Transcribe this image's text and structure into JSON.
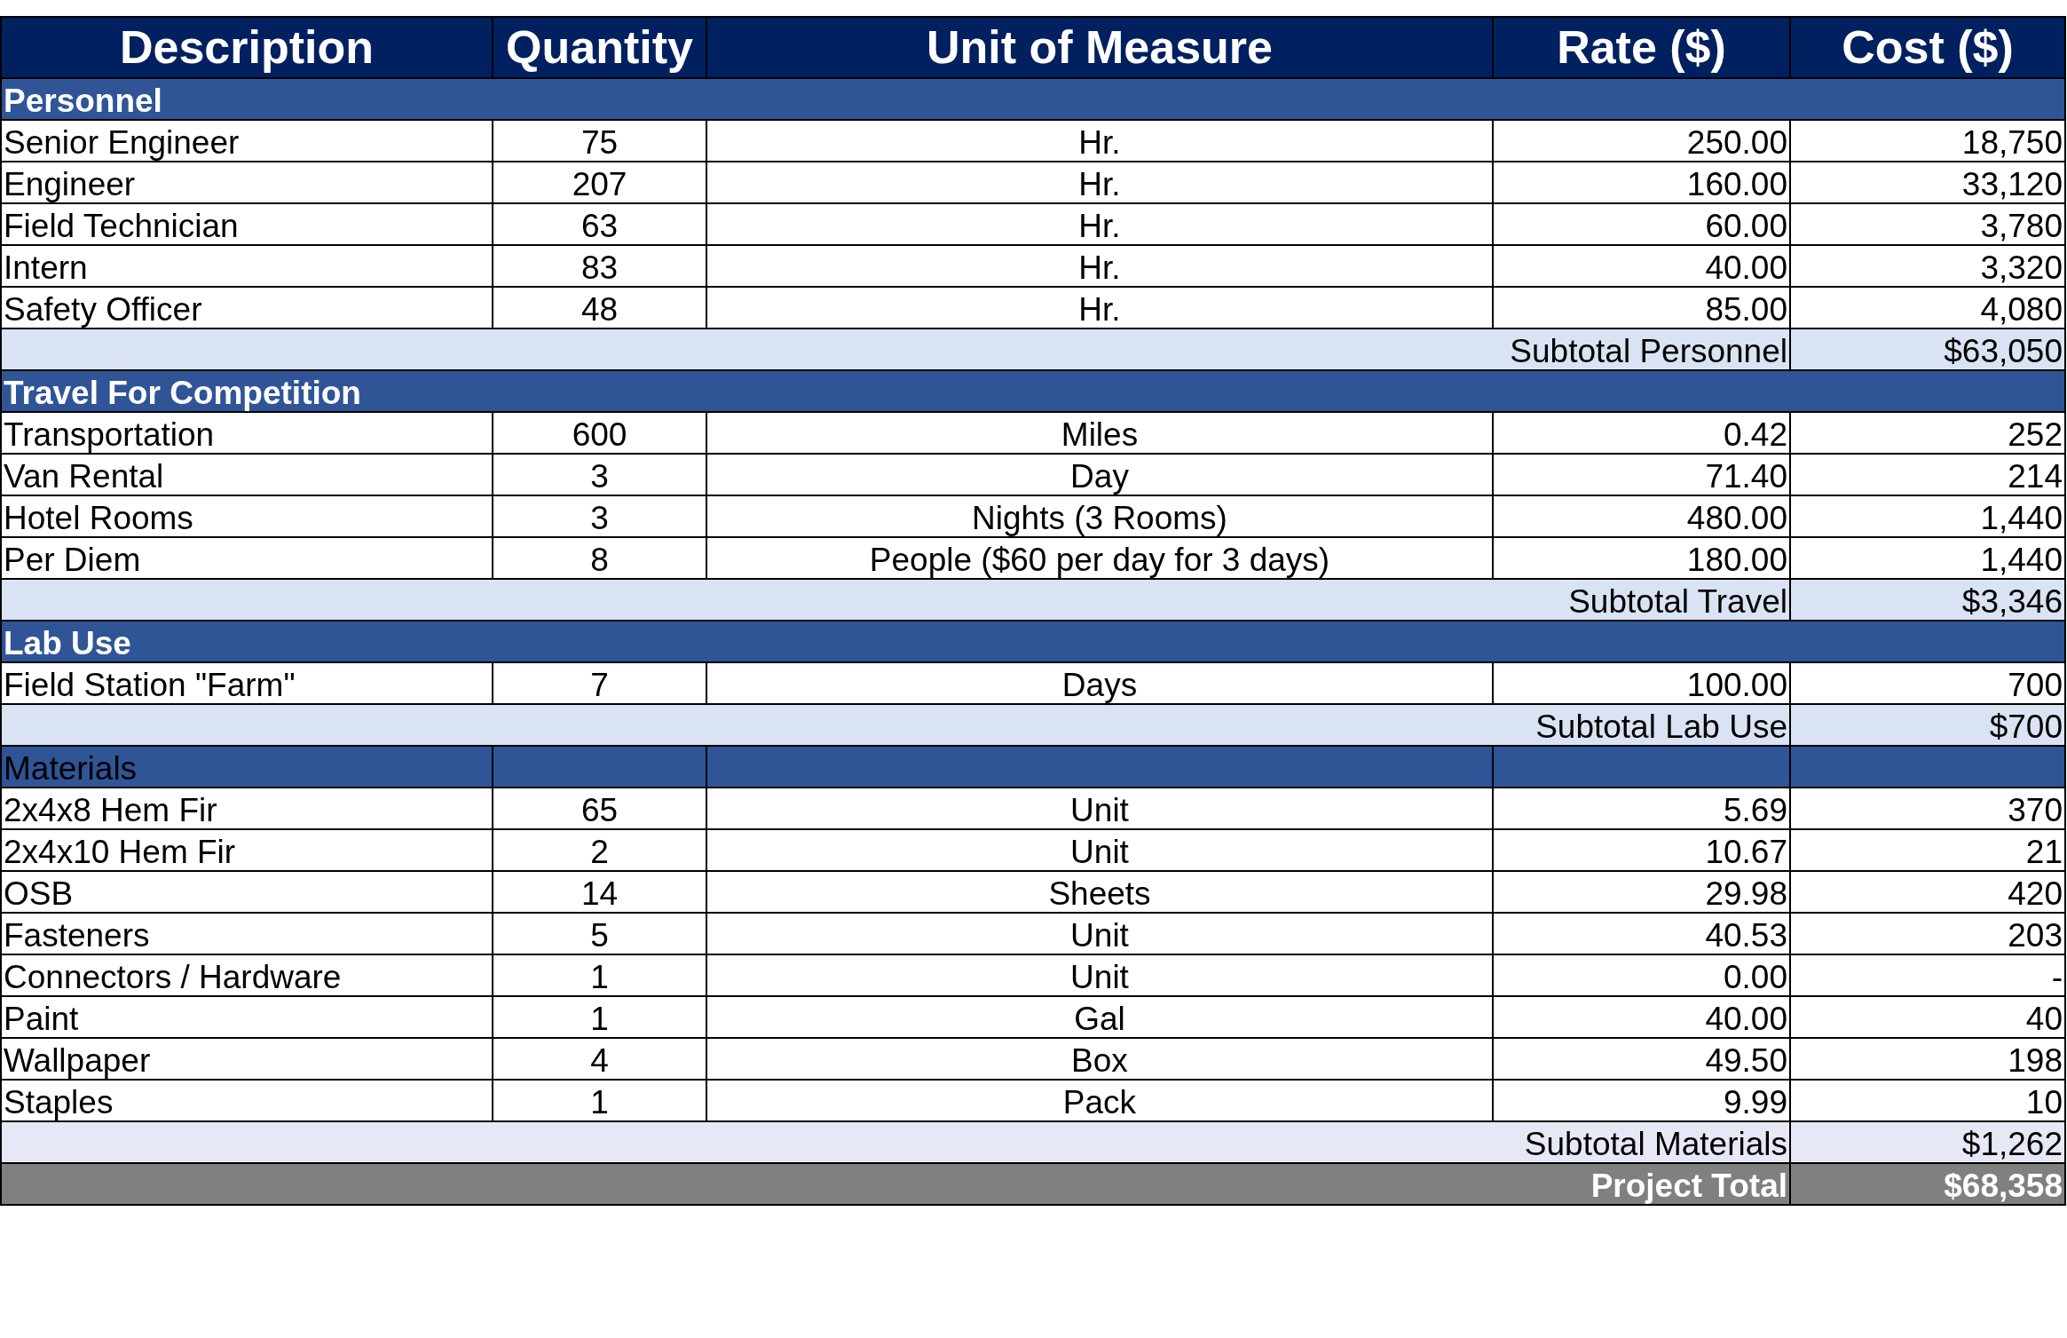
{
  "columns": [
    "Description",
    "Quantity",
    "Unit of Measure",
    "Rate ($)",
    "Cost ($)"
  ],
  "sections": [
    {
      "title": "Personnel",
      "kind": "band",
      "rows": [
        [
          "Senior Engineer",
          "75",
          "Hr.",
          "250.00",
          "18,750"
        ],
        [
          "Engineer",
          "207",
          "Hr.",
          "160.00",
          "33,120"
        ],
        [
          "Field Technician",
          "63",
          "Hr.",
          "60.00",
          "3,780"
        ],
        [
          "Intern",
          "83",
          "Hr.",
          "40.00",
          "3,320"
        ],
        [
          "Safety Officer",
          "48",
          "Hr.",
          "85.00",
          "4,080"
        ]
      ],
      "subtotal_label": "Subtotal Personnel",
      "subtotal_value": "$63,050"
    },
    {
      "title": "Travel For Competition",
      "kind": "band",
      "rows": [
        [
          "Transportation",
          "600",
          "Miles",
          "0.42",
          "252"
        ],
        [
          "Van Rental",
          "3",
          "Day",
          "71.40",
          "214"
        ],
        [
          "Hotel Rooms",
          "3",
          "Nights (3 Rooms)",
          "480.00",
          "1,440"
        ],
        [
          "Per Diem",
          "8",
          "People ($60 per day for 3 days)",
          "180.00",
          "1,440"
        ]
      ],
      "subtotal_label": "Subtotal Travel",
      "subtotal_value": "$3,346"
    },
    {
      "title": "Lab Use",
      "kind": "band",
      "rows": [
        [
          "Field Station \"Farm\"",
          "7",
          "Days",
          "100.00",
          "700"
        ]
      ],
      "subtotal_label": "Subtotal Lab Use",
      "subtotal_value": "$700"
    },
    {
      "title": "Materials",
      "kind": "grid",
      "rows": [
        [
          "2x4x8 Hem Fir",
          "65",
          "Unit",
          "5.69",
          "370"
        ],
        [
          "2x4x10 Hem Fir",
          "2",
          "Unit",
          "10.67",
          "21"
        ],
        [
          "OSB",
          "14",
          "Sheets",
          "29.98",
          "420"
        ],
        [
          "Fasteners",
          "5",
          "Unit",
          "40.53",
          "203"
        ],
        [
          "Connectors / Hardware",
          "1",
          "Unit",
          "0.00",
          "-"
        ],
        [
          "Paint",
          "1",
          "Gal",
          "40.00",
          "40"
        ],
        [
          "Wallpaper",
          "4",
          "Box",
          "49.50",
          "198"
        ],
        [
          "Staples",
          "1",
          "Pack",
          "9.99",
          "10"
        ]
      ],
      "subtotal_label": "Subtotal Materials",
      "subtotal_value": "$1,262"
    }
  ],
  "total": {
    "label": "Project Total",
    "value": "$68,358"
  }
}
